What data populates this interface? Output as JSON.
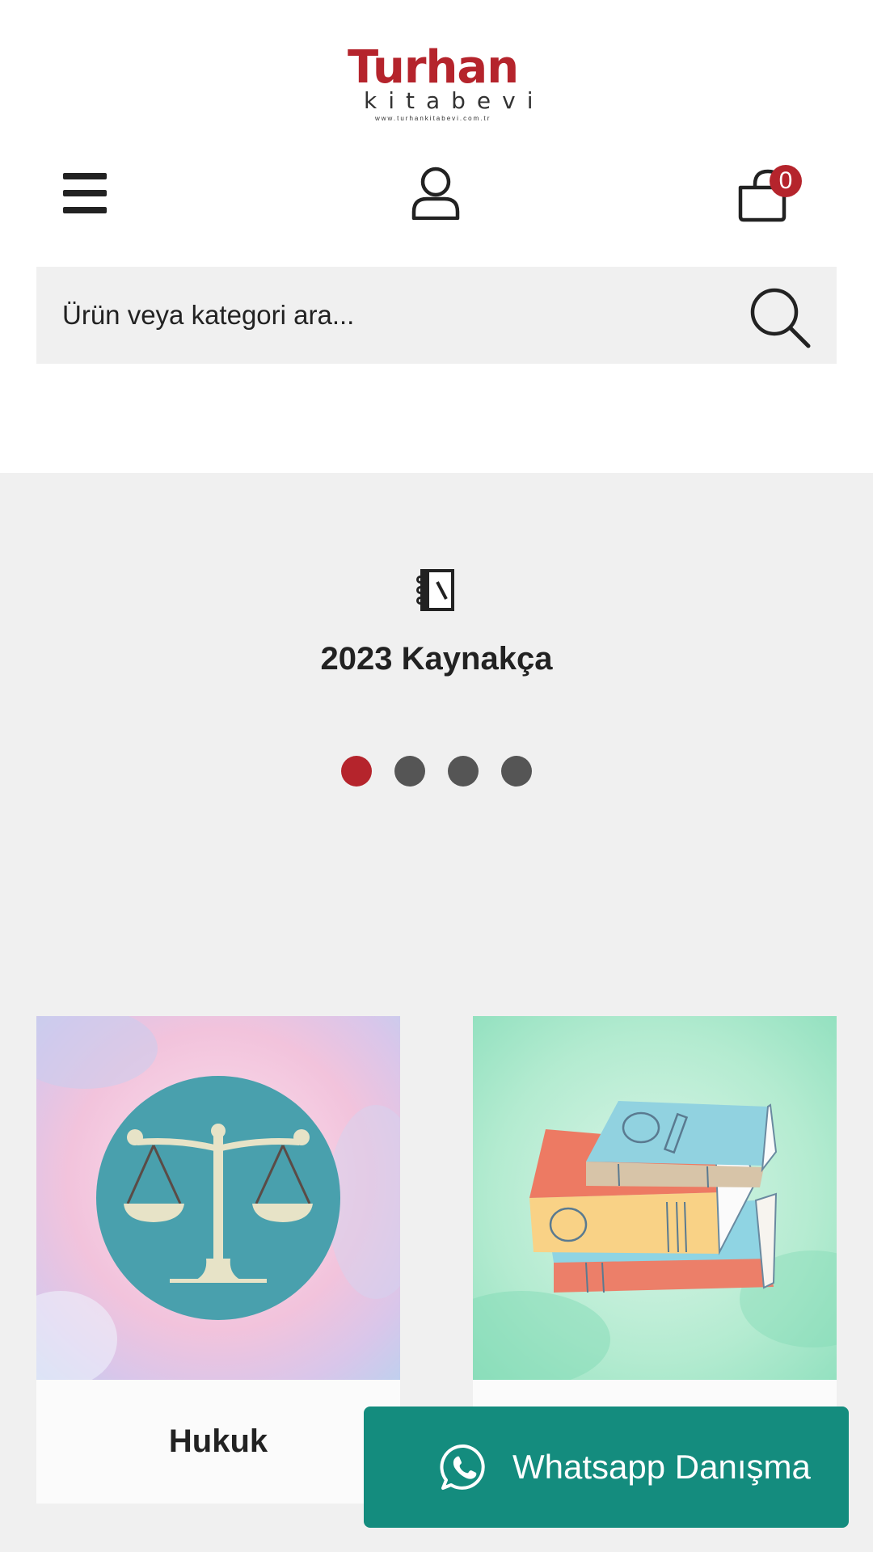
{
  "logo": {
    "top": "Turhan",
    "bottom": "kitabevi",
    "url": "www.turhankitabevi.com.tr"
  },
  "header": {
    "cart_count": "0"
  },
  "search": {
    "placeholder": "Ürün veya kategori ara..."
  },
  "slider": {
    "title": "2023 Kaynakça",
    "icon": "notebook-icon",
    "dots": [
      {
        "active": true
      },
      {
        "active": false
      },
      {
        "active": false
      },
      {
        "active": false
      }
    ]
  },
  "categories": [
    {
      "label": "Hukuk",
      "icon": "scales-icon"
    },
    {
      "label": "",
      "icon": "books-stack-icon"
    }
  ],
  "whatsapp": {
    "label": "Whatsapp Danışma"
  },
  "colors": {
    "brand_red": "#b5242c",
    "whatsapp_green": "#148c7e",
    "background": "#f0f0f0"
  }
}
